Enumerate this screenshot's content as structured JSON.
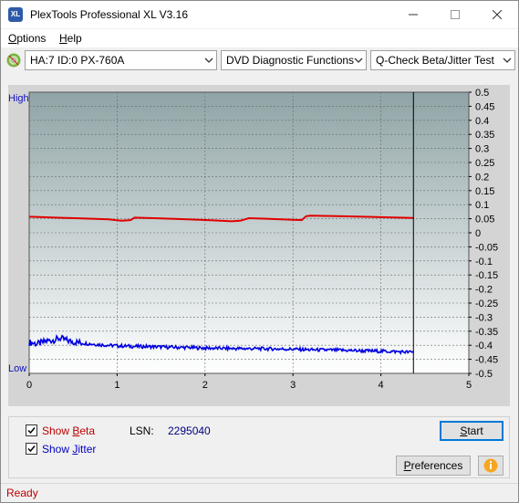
{
  "window": {
    "title": "PlexTools Professional XL V3.16",
    "app_icon_text": "XL"
  },
  "menu": {
    "items": [
      {
        "label": "Options",
        "underline": "O",
        "rest": "ptions"
      },
      {
        "label": "Help",
        "underline": "H",
        "rest": "elp"
      }
    ]
  },
  "toolbar": {
    "drive": "HA:7 ID:0  PX-760A",
    "function": "DVD Diagnostic Functions",
    "test": "Q-Check Beta/Jitter Test"
  },
  "chart": {
    "left_top_label": "High",
    "left_bottom_label": "Low",
    "x_ticks": [
      "0",
      "1",
      "2",
      "3",
      "4",
      "5"
    ],
    "y_ticks": [
      "0.5",
      "0.45",
      "0.4",
      "0.35",
      "0.3",
      "0.25",
      "0.2",
      "0.15",
      "0.1",
      "0.05",
      "0",
      "-0.05",
      "-0.1",
      "-0.15",
      "-0.2",
      "-0.25",
      "-0.3",
      "-0.35",
      "-0.4",
      "-0.45",
      "-0.5"
    ],
    "colors": {
      "beta": "#e00000",
      "jitter": "#0000e0",
      "bg_top": "#8fa4a6",
      "bg_bottom": "#ffffff",
      "grid": "#6a6a6a"
    }
  },
  "chart_data": {
    "type": "line",
    "x_range": [
      0,
      5
    ],
    "y_range": [
      -0.5,
      0.5
    ],
    "end_marker_x": 4.37,
    "grid": true,
    "series": [
      {
        "name": "Beta",
        "x": [
          0,
          0.3,
          0.6,
          0.9,
          1.05,
          1.15,
          1.2,
          1.5,
          1.8,
          2.1,
          2.3,
          2.4,
          2.5,
          2.7,
          3.0,
          3.1,
          3.15,
          3.2,
          3.5,
          3.8,
          4.1,
          4.37
        ],
        "y": [
          0.057,
          0.054,
          0.051,
          0.048,
          0.043,
          0.045,
          0.054,
          0.051,
          0.048,
          0.044,
          0.041,
          0.043,
          0.052,
          0.05,
          0.046,
          0.045,
          0.059,
          0.061,
          0.059,
          0.057,
          0.055,
          0.053
        ]
      },
      {
        "name": "Jitter",
        "x": [
          0,
          0.1,
          0.2,
          0.3,
          0.35,
          0.45,
          0.6,
          0.8,
          1.0,
          1.2,
          1.4,
          1.6,
          1.8,
          2.0,
          2.2,
          2.4,
          2.6,
          2.8,
          3.0,
          3.2,
          3.4,
          3.6,
          3.8,
          4.0,
          4.2,
          4.37
        ],
        "y": [
          -0.39,
          -0.395,
          -0.385,
          -0.38,
          -0.375,
          -0.385,
          -0.392,
          -0.398,
          -0.402,
          -0.404,
          -0.405,
          -0.407,
          -0.408,
          -0.41,
          -0.411,
          -0.412,
          -0.412,
          -0.413,
          -0.414,
          -0.416,
          -0.417,
          -0.418,
          -0.42,
          -0.421,
          -0.423,
          -0.425
        ]
      }
    ]
  },
  "options": {
    "show_beta": {
      "prefix": "Show ",
      "underline": "B",
      "rest": "eta",
      "checked": true
    },
    "show_jitter": {
      "prefix": "Show ",
      "underline": "J",
      "rest": "itter",
      "checked": true
    },
    "lsn_label": "LSN:",
    "lsn_value": "2295040"
  },
  "buttons": {
    "start": {
      "underline": "S",
      "rest": "tart"
    },
    "preferences": {
      "underline": "P",
      "rest": "references"
    }
  },
  "status": {
    "text": "Ready"
  }
}
